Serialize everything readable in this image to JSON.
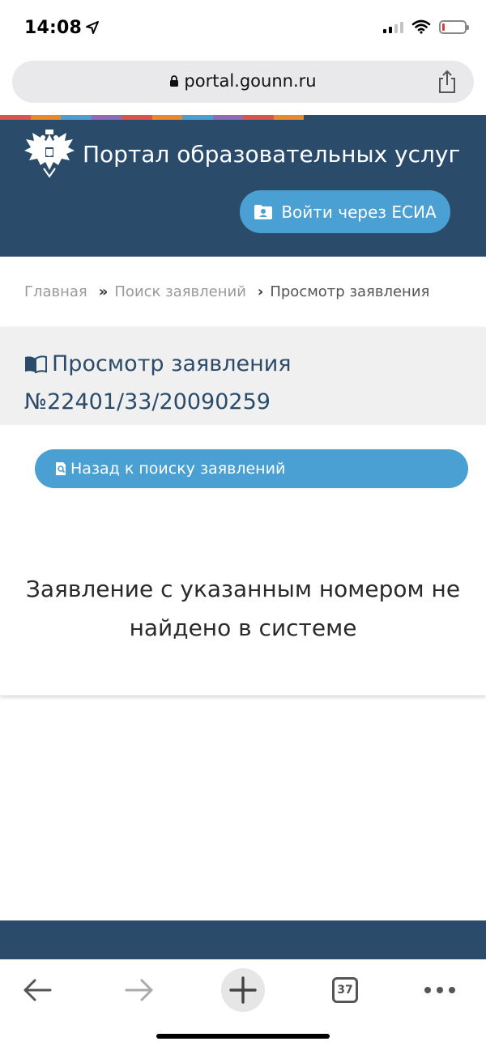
{
  "status_bar": {
    "time": "14:08"
  },
  "browser": {
    "url": "portal.gounn.ru",
    "tabs_count": "37"
  },
  "header": {
    "portal_title": "Портал образовательных услуг",
    "esia_button_label": "Войти через ЕСИА",
    "stripe_colors": [
      "#d9534f",
      "#e8892b",
      "#4a9fd3",
      "#8e6bb3",
      "#d9534f",
      "#e8892b",
      "#4a9fd3",
      "#8e6bb3",
      "#d9534f",
      "#e8892b"
    ]
  },
  "breadcrumb": {
    "items": [
      "Главная",
      "Поиск заявлений",
      "Просмотр заявления"
    ],
    "separators": [
      "»",
      "›"
    ]
  },
  "card": {
    "title_line1": "Просмотр заявления",
    "title_line2": "№22401/33/20090259",
    "back_button_label": "Назад к поиску заявлений",
    "message_line1": "Заявление с указанным номером не",
    "message_line2": "найдено в системе"
  },
  "colors": {
    "header_bg": "#2b4b6b",
    "button_bg": "#4a9fd3",
    "card_header_bg": "#f0f0f0"
  },
  "icons": {
    "location": "location-arrow-icon",
    "signal": "cellular-signal-icon",
    "wifi": "wifi-icon",
    "battery": "battery-icon",
    "lock": "lock-icon",
    "share": "share-icon",
    "emblem": "coat-of-arms-emblem",
    "esia": "user-folder-icon",
    "book": "open-book-icon",
    "search": "search-document-icon",
    "back": "back-arrow-icon",
    "forward": "forward-arrow-icon",
    "new_tab": "plus-icon",
    "tabs": "tabs-icon",
    "menu": "more-dots-icon"
  }
}
